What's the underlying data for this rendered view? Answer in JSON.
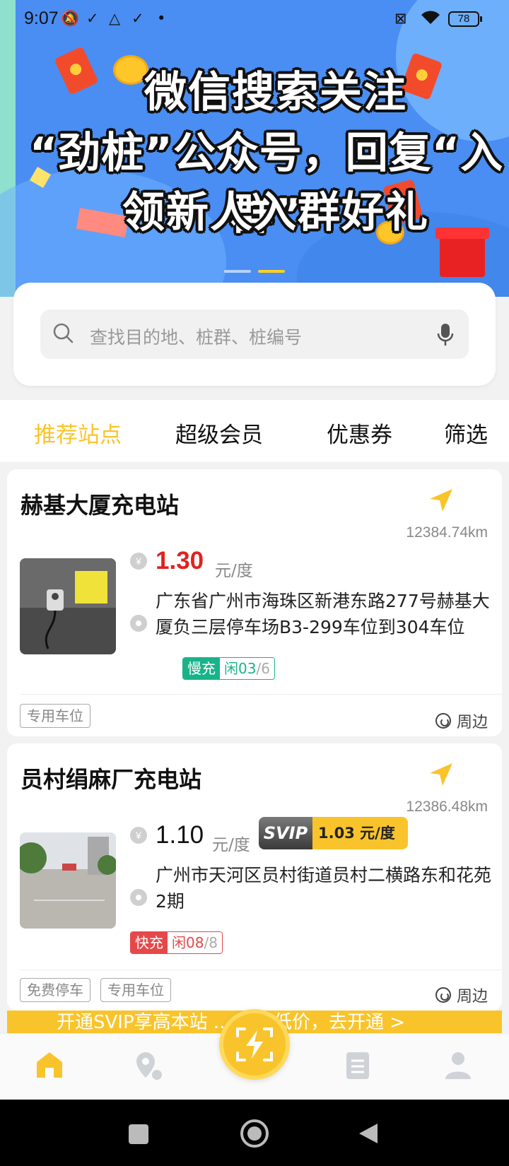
{
  "status_bar": {
    "time": "9:07",
    "battery": "78"
  },
  "banner": {
    "line1": "微信搜索关注",
    "line2": "“劲桩”公众号，回复“入群”",
    "line3": "领新人入群好礼",
    "slide_count": 2,
    "active_slide": 2
  },
  "search": {
    "placeholder": "查找目的地、桩群、桩编号"
  },
  "tabs": [
    {
      "label": "推荐站点",
      "active": true
    },
    {
      "label": "超级会员",
      "active": false
    },
    {
      "label": "优惠券",
      "active": false
    },
    {
      "label": "筛选",
      "active": false
    }
  ],
  "stations": [
    {
      "name": "赫基大厦充电站",
      "distance": "12384.74km",
      "price": "1.30",
      "unit": "元/度",
      "address": "广东省广州市海珠区新港东路277号赫基大厦负三层停车场B3-299车位到304车位",
      "charge_type": "慢充",
      "idle_label": "闲",
      "idle": "03",
      "total": "/6",
      "tags": [
        "专用车位"
      ],
      "around": "周边"
    },
    {
      "name": "员村绢麻厂充电站",
      "distance": "12386.48km",
      "price": "1.10",
      "unit": "元/度",
      "svip_label": "SVIP",
      "svip_price": "1.03 元/度",
      "address": "广州市天河区员村街道员村二横路东和花苑2期",
      "charge_type": "快充",
      "idle_label": "闲",
      "idle": "08",
      "total": "/8",
      "tags": [
        "免费停车",
        "专用车位"
      ],
      "around": "周边"
    }
  ],
  "promo": {
    "text": "开通SVIP享高本站 ... 元超低价，去开通 >"
  },
  "colors": {
    "accent": "#f9c42b",
    "price_red": "#e0231f",
    "slow_green": "#19b38a",
    "fast_red": "#e5484a",
    "banner_blue": "#4a8ef3"
  },
  "bottom_nav": [
    "home-icon",
    "map-icon",
    "scan-charge-icon",
    "orders-icon",
    "profile-icon"
  ]
}
